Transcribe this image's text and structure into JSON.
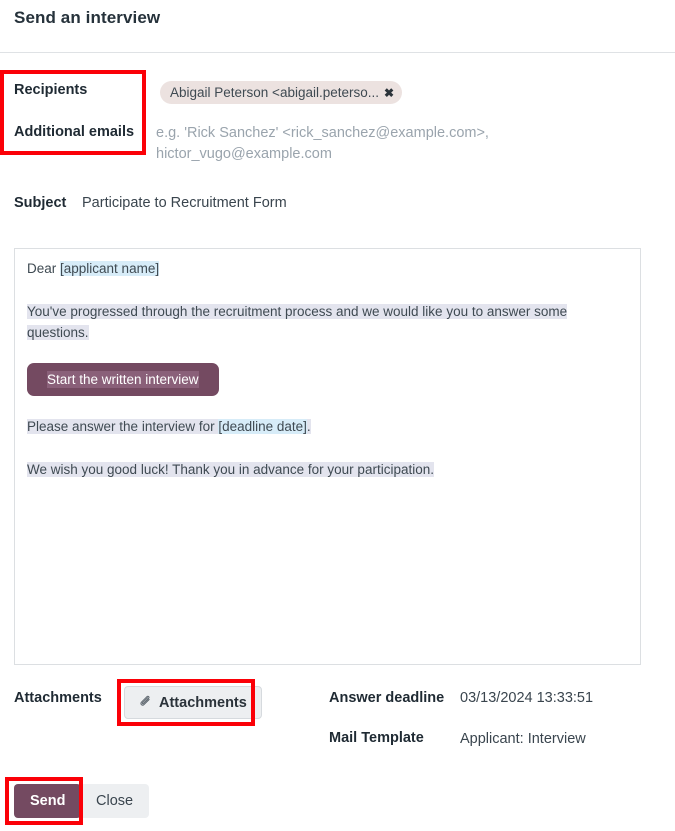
{
  "dialog": {
    "title": "Send an interview"
  },
  "fields": {
    "recipients_label": "Recipients",
    "additional_emails_label": "Additional emails",
    "subject_label": "Subject",
    "attachments_label": "Attachments"
  },
  "recipients": {
    "chip_label": "Abigail Peterson <abigail.peterso...",
    "chip_close_icon": "✖"
  },
  "additional_emails": {
    "placeholder_line1": "e.g.  'Rick Sanchez' <rick_sanchez@example.com>,",
    "placeholder_line2": "hictor_vugo@example.com"
  },
  "subject": {
    "value": "Participate to Recruitment Form"
  },
  "body": {
    "greeting_prefix": "Dear ",
    "greeting_token": "[applicant name]",
    "intro": "You've progressed through the recruitment process and we would like you to answer some questions.",
    "cta_label": "Start the written interview",
    "deadline_prefix": "Please answer the interview for ",
    "deadline_token": "[deadline date]",
    "deadline_suffix": ".",
    "closing": "We wish you good luck! Thank you in advance for your participation."
  },
  "attachments": {
    "button_label": "Attachments",
    "clip_icon": "📎"
  },
  "meta": {
    "answer_deadline_label": "Answer deadline",
    "answer_deadline_value": "03/13/2024 13:33:51",
    "mail_template_label": "Mail Template",
    "mail_template_value": "Applicant: Interview"
  },
  "footer": {
    "send_label": "Send",
    "close_label": "Close"
  },
  "colors": {
    "accent_purple": "#744a61",
    "annotation_red": "#fb0007",
    "chip_background": "#ece2e0",
    "token_highlight_blue": "#d7ecf8",
    "text_highlight_grey": "#e3e4ee"
  }
}
